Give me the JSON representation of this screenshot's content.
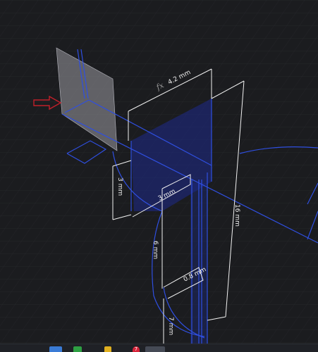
{
  "dimensions": {
    "top_width": "4.2 mm",
    "fx_label": "fx",
    "left_height": "3 mm",
    "inner_width": "3 mm",
    "right_height": "16 mm",
    "lower_height": "6 mm",
    "diameter": "0.8 mm",
    "bottom_height": "7 mm"
  },
  "taskbar": {
    "badge_count": "7"
  },
  "colors": {
    "background": "#1b1c1f",
    "sketch_line": "#2f4fe0",
    "dimension_line": "#f2f2f2",
    "face_fill": "#1e2a8a",
    "arrow": "#c0202a",
    "plane": "#9a9aa0"
  },
  "icons": {
    "direction_arrow": "red-arrow-icon",
    "formula_icon": "fx-icon"
  }
}
